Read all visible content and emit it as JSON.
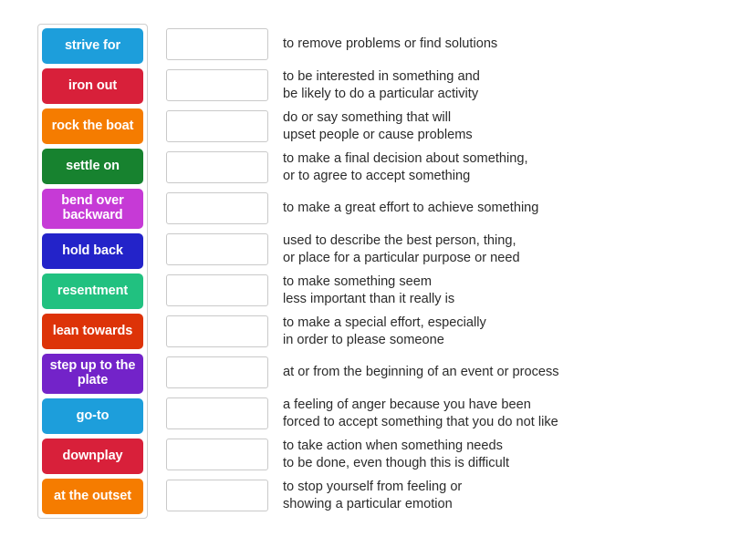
{
  "activity": {
    "type": "match-up",
    "tiles_panel_label": "draggable answer tiles",
    "rows_panel_label": "definition drop zones"
  },
  "tiles": [
    {
      "label": "strive for",
      "color": "#1d9edb",
      "lines": 1
    },
    {
      "label": "iron out",
      "color": "#d8203a",
      "lines": 1
    },
    {
      "label": "rock the boat",
      "color": "#f57c00",
      "lines": 1
    },
    {
      "label": "settle on",
      "color": "#17822f",
      "lines": 1
    },
    {
      "label": "bend over\nbackward",
      "color": "#c63ad6",
      "lines": 2
    },
    {
      "label": "hold back",
      "color": "#2323c9",
      "lines": 1
    },
    {
      "label": "resentment",
      "color": "#21c180",
      "lines": 1
    },
    {
      "label": "lean towards",
      "color": "#dd3308",
      "lines": 1
    },
    {
      "label": "step up to\nthe plate",
      "color": "#7323c9",
      "lines": 2
    },
    {
      "label": "go-to",
      "color": "#1d9edb",
      "lines": 1
    },
    {
      "label": "downplay",
      "color": "#d8203a",
      "lines": 1
    },
    {
      "label": "at the outset",
      "color": "#f57c00",
      "lines": 1
    }
  ],
  "rows": [
    {
      "answer": "",
      "definition": "to remove problems or find solutions"
    },
    {
      "answer": "",
      "definition": "to be interested in something and\nbe likely to do a particular activity"
    },
    {
      "answer": "",
      "definition": "do or say something that will\nupset people or cause problems"
    },
    {
      "answer": "",
      "definition": "to make a final decision about something,\nor to agree to accept something"
    },
    {
      "answer": "",
      "definition": "to make a great effort to achieve something"
    },
    {
      "answer": "",
      "definition": "used to describe the best person, thing,\nor place for a particular purpose or need"
    },
    {
      "answer": "",
      "definition": "to make something seem\nless important than it really is"
    },
    {
      "answer": "",
      "definition": "to make a special effort, especially\nin order to please someone"
    },
    {
      "answer": "",
      "definition": "at or from the beginning of an event or process"
    },
    {
      "answer": "",
      "definition": "a feeling of anger because you have been\nforced to accept something that you do not like"
    },
    {
      "answer": "",
      "definition": "to take action when something needs\nto be done, even though this is difficult"
    },
    {
      "answer": "",
      "definition": "to stop yourself from feeling or\nshowing a particular emotion"
    }
  ],
  "colors": {
    "page_background": "#ffffff",
    "panel_border": "#cfcfcf",
    "box_border": "#c9c9c9",
    "definition_text": "#2b2b2b",
    "tile_text": "#ffffff"
  }
}
